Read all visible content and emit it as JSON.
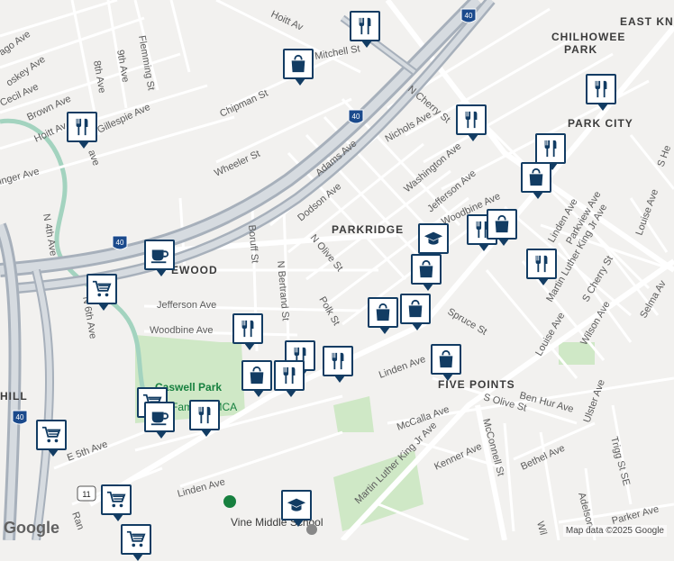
{
  "neighborhoods": [
    {
      "id": "east-knox",
      "label": "EAST KN"
    },
    {
      "id": "chilhowee-park",
      "label": "CHILHOWEE"
    },
    {
      "id": "chilhowee-park-2",
      "label": "PARK"
    },
    {
      "id": "park-city",
      "label": "PARK CITY"
    },
    {
      "id": "parkridge",
      "label": "PARKRIDGE"
    },
    {
      "id": "edgewood",
      "label": "EWOOD"
    },
    {
      "id": "five-points",
      "label": "FIVE POINTS"
    },
    {
      "id": "hill",
      "label": "HILL"
    }
  ],
  "streets": [
    "ago Ave",
    "oskey Ave",
    "Cecil Ave",
    "Brown Ave",
    "Hoitt Av",
    "ave",
    "inger Ave",
    "8th Ave",
    "9th Ave",
    "Flemming St",
    "Hoitt Av",
    "Mitchell St",
    "Chipman St",
    "Wheeler St",
    "N 4th Ave",
    "Gillespie Ave",
    "N 6th Ave",
    "Adams Ave",
    "Dodson Ave",
    "N Olive St",
    "N Bertrand St",
    "Boruff St",
    "Jefferson Ave",
    "Woodbine Ave",
    "Polk St",
    "N Cherry St",
    "Nichols Ave",
    "Washington Ave",
    "Jefferson Ave",
    "Woodbine Ave",
    "Linden Ave",
    "Parkview Ave",
    "Louise Ave",
    "S He",
    "Martin Luther King Jr Ave",
    "S Cherry St",
    "Wilson Ave",
    "Louise Ave",
    "Selma Av",
    "Spruce St",
    "Linden Ave",
    "Ben Hur Ave",
    "S Olive St",
    "Ulster Ave",
    "McCalla Ave",
    "Martin Luther King Jr Ave",
    "McConnell St",
    "Kenner Ave",
    "Bethel Ave",
    "Trigg St SE",
    "E 5th Ave",
    "Linden Ave",
    "Ran",
    "Adelson",
    "Wil",
    "Parker Ave"
  ],
  "interstate_shields": [
    "40",
    "40",
    "40",
    "40"
  ],
  "us_shield": "11",
  "pois": {
    "park": "Caswell Park",
    "ymca": "Family YMCA",
    "school": "Vine Middle School"
  },
  "attribution": {
    "logo": "Google",
    "copyright": "Map data ©2025 Google"
  },
  "colors": {
    "background": "#f2f1ef",
    "road": "#ffffff",
    "highway": "#a7b0bb",
    "park": "#cfe8c6",
    "water": "#a3d3bf",
    "pin": "#123c63"
  },
  "markers": [
    {
      "type": "restaurant-icon"
    },
    {
      "type": "shopping-bag-icon"
    },
    {
      "type": "restaurant-icon"
    },
    {
      "type": "restaurant-icon"
    },
    {
      "type": "restaurant-icon"
    },
    {
      "type": "restaurant-icon"
    },
    {
      "type": "shopping-bag-icon"
    },
    {
      "type": "restaurant-icon"
    },
    {
      "type": "shopping-bag-icon"
    },
    {
      "type": "graduation-cap-icon"
    },
    {
      "type": "shopping-bag-icon"
    },
    {
      "type": "restaurant-icon"
    },
    {
      "type": "coffee-cup-icon"
    },
    {
      "type": "shopping-cart-icon"
    },
    {
      "type": "shopping-bag-icon"
    },
    {
      "type": "shopping-bag-icon"
    },
    {
      "type": "restaurant-icon"
    },
    {
      "type": "restaurant-icon"
    },
    {
      "type": "restaurant-icon"
    },
    {
      "type": "shopping-bag-icon"
    },
    {
      "type": "restaurant-icon"
    },
    {
      "type": "shopping-bag-icon"
    },
    {
      "type": "shopping-cart-icon"
    },
    {
      "type": "coffee-cup-icon"
    },
    {
      "type": "restaurant-icon"
    },
    {
      "type": "shopping-cart-icon"
    },
    {
      "type": "shopping-cart-icon"
    },
    {
      "type": "shopping-cart-icon"
    },
    {
      "type": "graduation-cap-icon"
    }
  ]
}
